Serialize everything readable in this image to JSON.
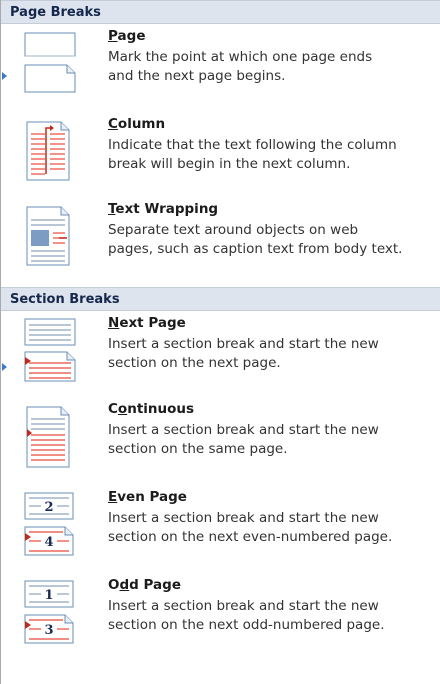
{
  "sections": [
    {
      "header": "Page Breaks",
      "items": [
        {
          "title_pre": "",
          "title_u": "P",
          "title_post": "age",
          "desc_lines": [
            "Mark the point at which one page ends",
            "and the next page begins."
          ],
          "icon": "page-break-icon"
        },
        {
          "title_pre": "",
          "title_u": "C",
          "title_post": "olumn",
          "desc_lines": [
            "Indicate that the text following the column",
            "break will begin in the next column."
          ],
          "icon": "column-break-icon"
        },
        {
          "title_pre": "",
          "title_u": "T",
          "title_post": "ext Wrapping",
          "desc_lines": [
            "Separate text around objects on web",
            "pages, such as caption text from body text."
          ],
          "icon": "text-wrapping-icon"
        }
      ]
    },
    {
      "header": "Section Breaks",
      "items": [
        {
          "title_pre": "",
          "title_u": "N",
          "title_post": "ext Page",
          "desc_lines": [
            "Insert a section break and start the new",
            "section on the next page."
          ],
          "icon": "next-page-section-icon"
        },
        {
          "title_pre": "C",
          "title_u": "o",
          "title_post": "ntinuous",
          "desc_lines": [
            "Insert a section break and start the new",
            "section on the same page."
          ],
          "icon": "continuous-section-icon"
        },
        {
          "title_pre": "",
          "title_u": "E",
          "title_post": "ven Page",
          "desc_lines": [
            "Insert a section break and start the new",
            "section on the next even-numbered page."
          ],
          "icon": "even-page-section-icon",
          "numbers": [
            "2",
            "4"
          ]
        },
        {
          "title_pre": "O",
          "title_u": "d",
          "title_post": "d Page",
          "desc_lines": [
            "Insert a section break and start the new",
            "section on the next odd-numbered page."
          ],
          "icon": "odd-page-section-icon",
          "numbers": [
            "1",
            "3"
          ]
        }
      ]
    }
  ],
  "colors": {
    "accent": "#3c78c8",
    "red": "#e8493a",
    "header_bg": "#dde4ee"
  }
}
